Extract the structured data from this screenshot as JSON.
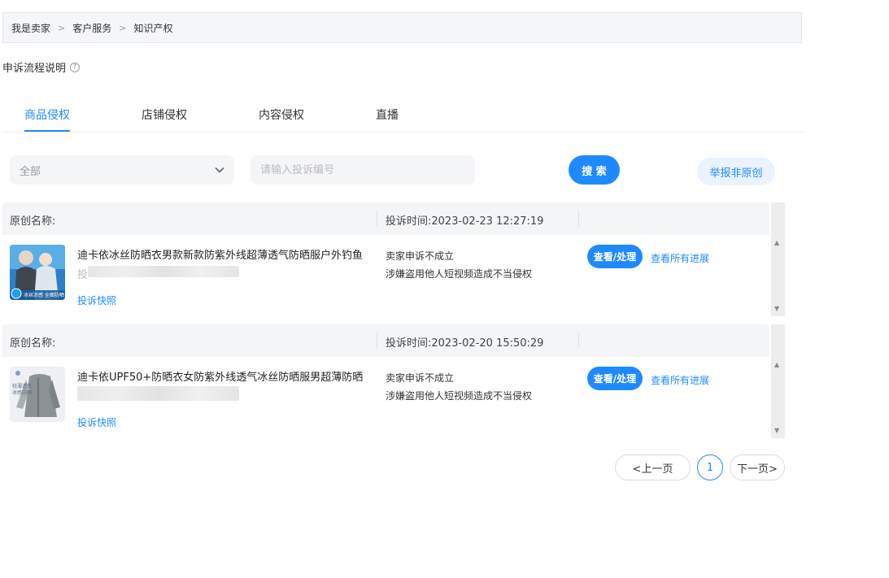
{
  "breadcrumb": [
    "我是卖家",
    "客户服务",
    "知识产权"
  ],
  "breadcrumb_sep": ">",
  "process_text": "申诉流程说明",
  "help_icon_glyph": "?",
  "tabs": [
    "商品侵权",
    "店铺侵权",
    "内容侵权",
    "直播"
  ],
  "active_tab": "商品侵权",
  "filter": {
    "select_value": "全部",
    "search_placeholder": "请输入投诉编号",
    "search_button": "搜 索",
    "report_button": "举报非原创"
  },
  "records": [
    {
      "name_label": "原创名称:",
      "time": "投诉时间:2023-02-23 12:27:19",
      "title": "迪卡依冰丝防晒衣男款新款防紫外线超薄透气防晒服户外钓鱼",
      "blur_prefix": "投",
      "snapshot": "投诉快照",
      "status": "卖家申诉不成立",
      "reason": "涉嫌盗用他人短视频造成不当侵权",
      "view_button": "查看/处理",
      "progress_link": "查看所有进展"
    },
    {
      "name_label": "原创名称:",
      "time": "投诉时间:2023-02-20 15:50:29",
      "title": "迪卡依UPF50+防晒衣女防紫外线透气冰丝防晒服男超薄防晒",
      "blur_prefix": "",
      "snapshot": "投诉快照",
      "status": "卖家申诉不成立",
      "reason": "涉嫌盗用他人短视频造成不当侵权",
      "view_button": "查看/处理",
      "progress_link": "查看所有进展"
    }
  ],
  "pagination": {
    "prev": "<上一页",
    "current": "1",
    "next": "下一页>"
  },
  "colors": {
    "accent": "#1f8aff",
    "panel": "#f4f5f7"
  }
}
